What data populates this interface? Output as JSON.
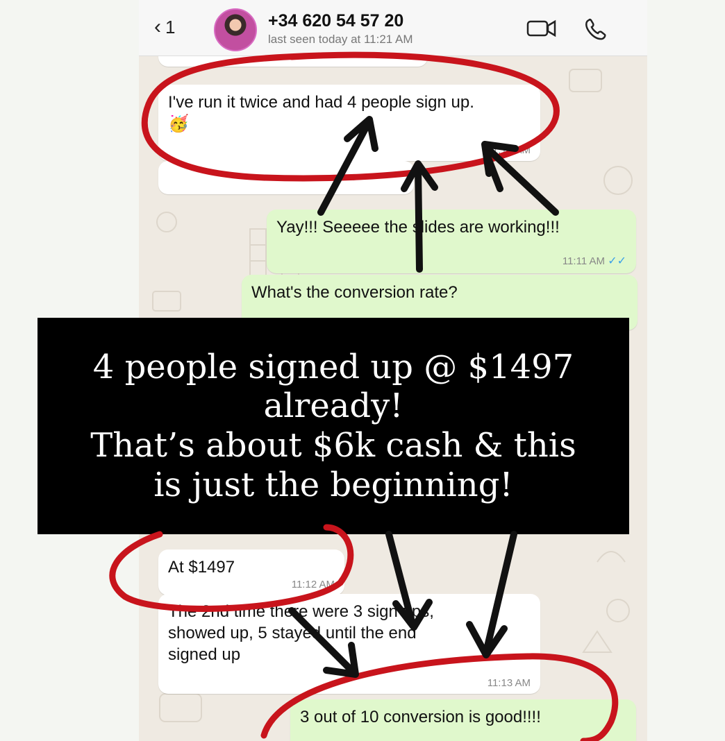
{
  "header": {
    "back_count": "1",
    "contact_number": "+34 620 54 57 20",
    "last_seen": "last seen today at 11:21 AM",
    "icons": [
      "back-chevron-icon",
      "video-call-icon",
      "phone-call-icon"
    ]
  },
  "messages": [
    {
      "dir": "in",
      "text": "I've run it twice and had 4 people sign up.",
      "emoji": "🥳",
      "time": "11:10 AM"
    },
    {
      "dir": "out",
      "text": "Yay!!! Seeeee the slides are working!!!",
      "time": "11:11 AM"
    },
    {
      "dir": "out",
      "text": "What's the conversion rate?",
      "time": ""
    },
    {
      "dir": "in",
      "text": "At $1497",
      "time": "11:12 AM"
    },
    {
      "dir": "in",
      "text_lines": [
        "The 2nd time there were 3 sign ups,",
        "showed up, 5 stayed until the end",
        "signed up"
      ],
      "time": "11:13 AM"
    },
    {
      "dir": "out",
      "text": "3 out of 10 conversion is good!!!!",
      "time": ""
    }
  ],
  "overlay": {
    "lines": [
      "4 people signed up @ $1497",
      "already!",
      "That’s about $6k cash & this",
      "is just the beginning!"
    ]
  },
  "colors": {
    "chat_bg": "#efeae2",
    "bubble_in": "#ffffff",
    "bubble_out": "#e0f8cc",
    "annotation_red": "#c8141c",
    "overlay_bg": "#000000",
    "read_tick": "#3aa0e8"
  }
}
